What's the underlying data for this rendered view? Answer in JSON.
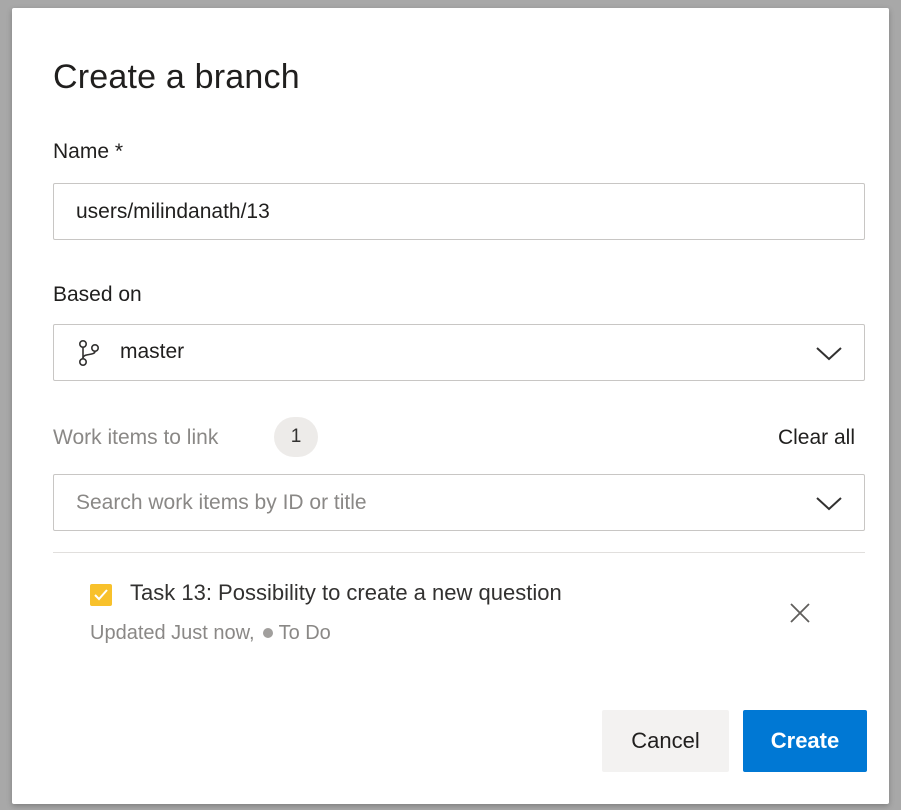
{
  "dialog": {
    "title": "Create a branch"
  },
  "name_field": {
    "label": "Name *",
    "value": "users/milindanath/13"
  },
  "based_on": {
    "label": "Based on",
    "selected": "master",
    "icon": "git-branch-icon"
  },
  "work_items": {
    "label": "Work items to link",
    "count": "1",
    "clear_all": "Clear all",
    "search_placeholder": "Search work items by ID or title",
    "items": [
      {
        "title": "Task 13: Possibility to create a new question",
        "updated": "Updated Just now,",
        "state": "To Do",
        "type_color": "#f8c12b"
      }
    ]
  },
  "actions": {
    "cancel": "Cancel",
    "create": "Create"
  },
  "colors": {
    "primary": "#0078d4",
    "task": "#f8c12b",
    "state_dot": "#a19f9d"
  }
}
